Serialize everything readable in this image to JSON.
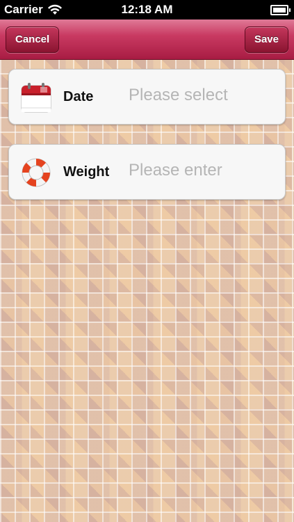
{
  "status_bar": {
    "carrier": "Carrier",
    "time": "12:18 AM"
  },
  "nav": {
    "cancel_label": "Cancel",
    "save_label": "Save",
    "accent_color": "#c93a62"
  },
  "form": {
    "date": {
      "label": "Date",
      "placeholder": "Please select",
      "icon": "calendar-icon"
    },
    "weight": {
      "label": "Weight",
      "placeholder": "Please enter",
      "icon": "lifebuoy-icon"
    }
  }
}
